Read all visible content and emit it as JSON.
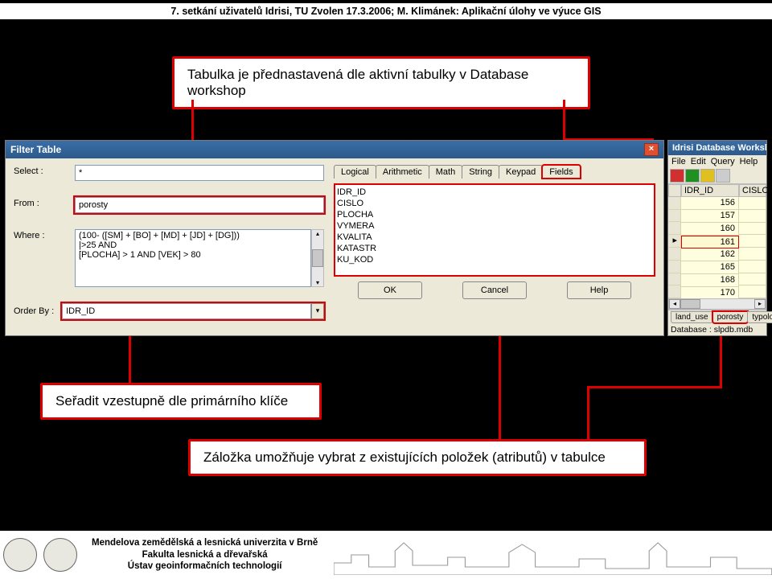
{
  "header": {
    "text": "7. setkání uživatelů Idrisi, TU Zvolen 17.3.2006; M. Klimánek: Aplikační úlohy ve výuce GIS"
  },
  "callouts": {
    "top": "Tabulka je přednastavená dle aktivní tabulky v Database workshop",
    "left": "Seřadit vzestupně dle primárního klíče",
    "bottom": "Záložka umožňuje vybrat z existujících položek (atributů) v tabulce"
  },
  "dialog": {
    "title": "Filter Table",
    "labels": {
      "select": "Select :",
      "from": "From :",
      "where": "Where :",
      "order": "Order By :"
    },
    "values": {
      "select": "*",
      "from": "porosty",
      "where": "(100- ([SM] + [BO] + [MD] + [JD] + [DG]))\n|>25 AND\n[PLOCHA] > 1 AND [VEK] > 80",
      "order": "IDR_ID"
    },
    "tabs": [
      "Logical",
      "Arithmetic",
      "Math",
      "String",
      "Keypad",
      "Fields"
    ],
    "fields": [
      "IDR_ID",
      "CISLO",
      "PLOCHA",
      "VYMERA",
      "KVALITA",
      "KATASTR",
      "KU_KOD"
    ],
    "buttons": {
      "ok": "OK",
      "cancel": "Cancel",
      "help": "Help"
    }
  },
  "workshop": {
    "title": "Idrisi Database Workshop",
    "menu": [
      "File",
      "Edit",
      "Query",
      "Help"
    ],
    "columns": [
      "IDR_ID",
      "CISLO"
    ],
    "rows": [
      156,
      157,
      160,
      161,
      162,
      165,
      168,
      170
    ],
    "selected_row_index": 3,
    "tabs": [
      "land_use",
      "porosty",
      "typologie"
    ],
    "active_tab_index": 1,
    "database_label": "Database :",
    "database_value": "slpdb.mdb"
  },
  "footer": {
    "line1": "Mendelova zemědělská a lesnická univerzita v Brně",
    "line2": "Fakulta lesnická a dřevařská",
    "line3": "Ústav geoinformačních technologií"
  }
}
